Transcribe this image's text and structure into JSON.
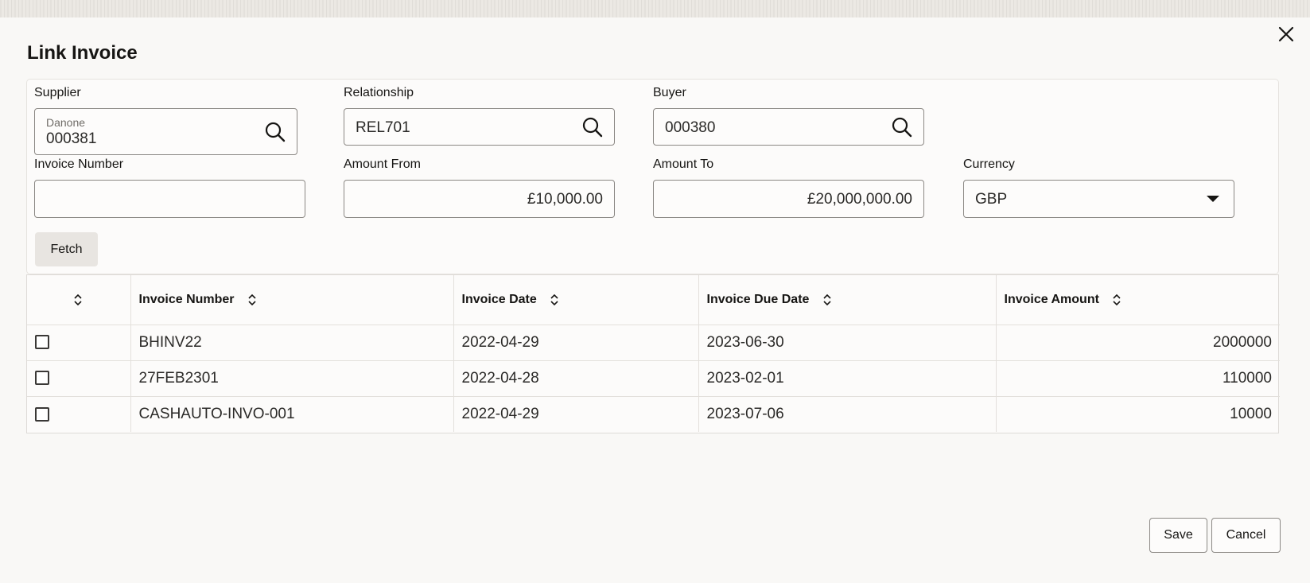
{
  "dialog": {
    "title": "Link Invoice"
  },
  "filters": {
    "supplier": {
      "label": "Supplier",
      "hint": "Danone",
      "value": "000381"
    },
    "relationship": {
      "label": "Relationship",
      "value": "REL701"
    },
    "buyer": {
      "label": "Buyer",
      "value": "000380"
    },
    "invoice_number": {
      "label": "Invoice Number",
      "value": ""
    },
    "amount_from": {
      "label": "Amount From",
      "value": "£10,000.00"
    },
    "amount_to": {
      "label": "Amount To",
      "value": "£20,000,000.00"
    },
    "currency": {
      "label": "Currency",
      "value": "GBP"
    },
    "fetch_label": "Fetch"
  },
  "table": {
    "columns": [
      "Invoice Number",
      "Invoice Date",
      "Invoice Due Date",
      "Invoice Amount"
    ],
    "rows": [
      {
        "invoice_number": "BHINV22",
        "invoice_date": "2022-04-29",
        "due_date": "2023-06-30",
        "amount": "2000000"
      },
      {
        "invoice_number": "27FEB2301",
        "invoice_date": "2022-04-28",
        "due_date": "2023-02-01",
        "amount": "110000"
      },
      {
        "invoice_number": "CASHAUTO-INVO-001",
        "invoice_date": "2022-04-29",
        "due_date": "2023-07-06",
        "amount": "10000"
      }
    ]
  },
  "footer": {
    "save_label": "Save",
    "cancel_label": "Cancel"
  },
  "icons": {
    "close": "close-icon",
    "search": "search-icon",
    "sort": "sort-icon",
    "dropdown": "chevron-down-icon"
  }
}
